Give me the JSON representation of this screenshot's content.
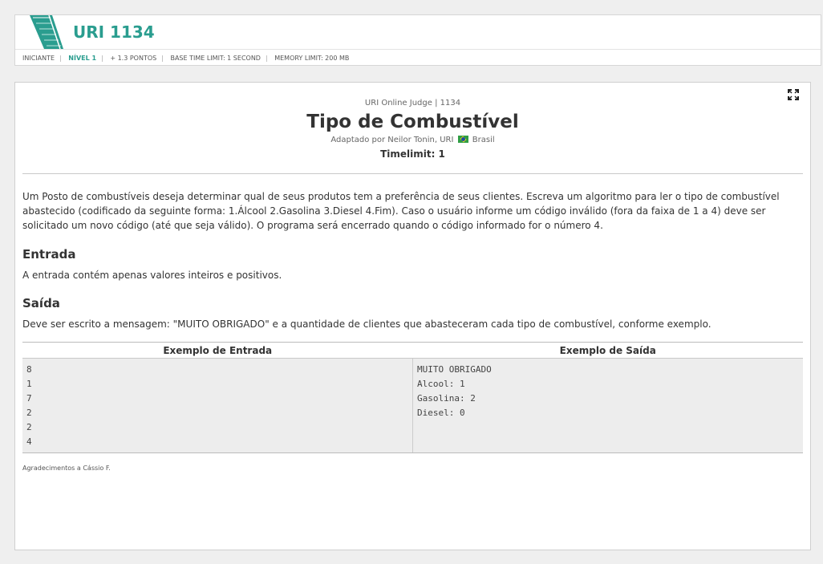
{
  "header": {
    "title": "URI 1134",
    "bar": [
      "INICIANTE",
      "NÍVEL 1",
      "+ 1.3 PONTOS",
      "BASE TIME LIMIT: 1 SECOND",
      "MEMORY LIMIT: 200 MB"
    ]
  },
  "problem": {
    "judge": "URI Online Judge | 1134",
    "title": "Tipo de Combustível",
    "author_prefix": "Adaptado por Neilor Tonin, URI",
    "country": "Brasil",
    "timelimit": "Timelimit: 1",
    "description": "Um Posto de combustíveis deseja determinar qual de seus produtos tem a preferência de seus clientes. Escreva um algoritmo para ler o tipo de combustível abastecido (codificado da seguinte forma: 1.Álcool 2.Gasolina 3.Diesel 4.Fim). Caso o usuário informe um código inválido (fora da faixa de 1 a 4) deve ser solicitado um novo código (até que seja válido). O programa será encerrado quando o código informado for o número 4.",
    "input_heading": "Entrada",
    "input_text": "A entrada contém apenas valores inteiros e positivos.",
    "output_heading": "Saída",
    "output_text": "Deve ser escrito a mensagem: \"MUITO OBRIGADO\" e a quantidade de clientes que abasteceram cada tipo de combustível, conforme exemplo.",
    "example_input_label": "Exemplo de Entrada",
    "example_output_label": "Exemplo de Saída",
    "example_input": [
      "8",
      "1",
      "7",
      "2",
      "2",
      "4"
    ],
    "example_output": [
      "MUITO OBRIGADO",
      "Alcool: 1",
      "Gasolina: 2",
      "Diesel: 0"
    ],
    "thanks": "Agradecimentos a Cássio F."
  },
  "icons": {
    "expand": "expand-icon",
    "logo": "uri-logo-icon",
    "flag": "brazil-flag-icon"
  },
  "colors": {
    "accent": "#2a9d8f"
  }
}
